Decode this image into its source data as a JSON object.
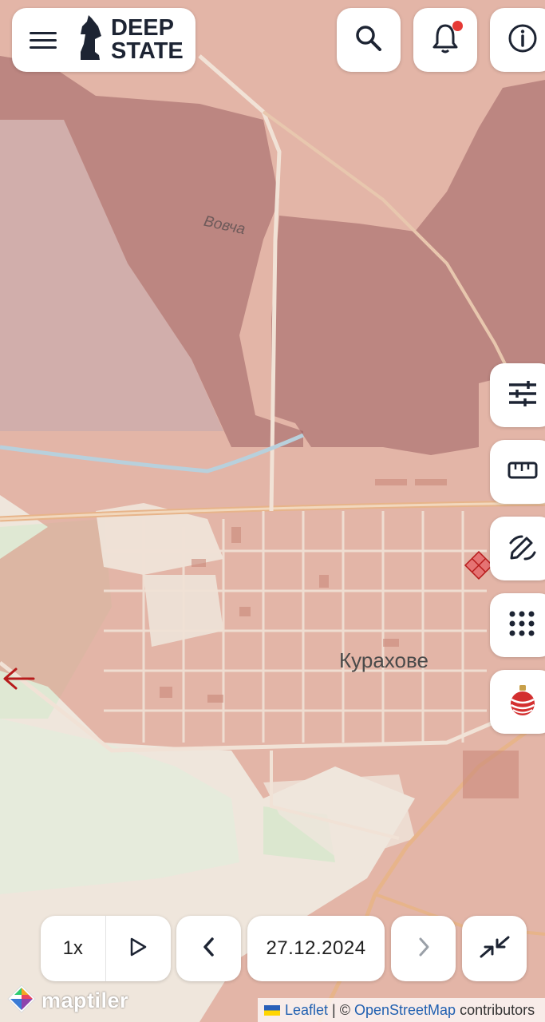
{
  "header": {
    "brand_line1": "DEEP",
    "brand_line2": "STATE"
  },
  "icons": {
    "menu": "hamburger-menu-icon",
    "logo": "knight-chess-icon",
    "search": "search-icon",
    "notifications": "bell-icon",
    "info": "info-icon",
    "filters": "sliders-icon",
    "ruler": "ruler-icon",
    "draw": "pen-draw-icon",
    "grid": "grid-dots-icon",
    "ornament": "christmas-ornament-icon",
    "play": "play-icon",
    "prev": "chevron-left-icon",
    "next": "chevron-right-icon",
    "collapse": "collapse-arrows-icon"
  },
  "notification_badge_color": "#e53935",
  "map": {
    "labels": {
      "river": "Вовча",
      "town": "Курахове"
    },
    "colors": {
      "occupied": "#a05a5a",
      "contested": "#d98c7c",
      "water": "#c8d8e4",
      "land": "#efe6dc",
      "green": "#d8e6cc"
    }
  },
  "controls": {
    "speed": "1x",
    "date": "27.12.2024"
  },
  "attribution": {
    "leaflet": "Leaflet",
    "separator": " | © ",
    "osm": "OpenStreetMap",
    "suffix": " contributors"
  },
  "maptiler_logo": "maptiler"
}
